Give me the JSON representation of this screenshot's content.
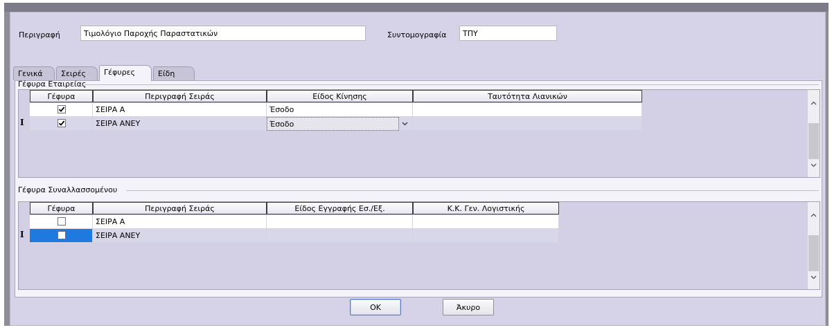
{
  "header": {
    "description_label": "Περιγραφή",
    "description_value": "Τιμολόγιο Παροχής Παραστατικών",
    "abbreviation_label": "Συντομογραφία",
    "abbreviation_value": "ΤΠΥ"
  },
  "tabs": [
    {
      "label": "Γενικά",
      "active": false
    },
    {
      "label": "Σειρές",
      "active": false
    },
    {
      "label": "Γέφυρες",
      "active": true
    },
    {
      "label": "Είδη",
      "active": false
    }
  ],
  "company_bridge": {
    "title": "Γέφυρα Εταιρείας",
    "columns": [
      "Γέφυρα",
      "Περιγραφή Σειράς",
      "Είδος Κίνησης",
      "Ταυτότητα Λιανικών"
    ],
    "rows": [
      {
        "checked": true,
        "series": "ΣΕΙΡΑ Α",
        "movement": "Έσοδο",
        "retail_id": ""
      },
      {
        "checked": true,
        "series": "ΣΕΙΡΑ ΑΝΕΥ",
        "movement": "Έσοδο",
        "retail_id": ""
      }
    ]
  },
  "counterparty_bridge": {
    "title": "Γέφυρα Συναλλασσομένου",
    "columns": [
      "Γέφυρα",
      "Περιγραφή Σειράς",
      "Είδος Εγγραφής Εσ./Εξ.",
      "Κ.Κ. Γεν. Λογιστικής"
    ],
    "rows": [
      {
        "checked": false,
        "series": "ΣΕΙΡΑ Α",
        "entry_type": "",
        "gl_account": ""
      },
      {
        "checked": false,
        "series": "ΣΕΙΡΑ ΑΝΕΥ",
        "entry_type": "",
        "gl_account": ""
      }
    ]
  },
  "buttons": {
    "ok": "OK",
    "cancel": "Άκυρο"
  },
  "colors": {
    "window_bg": "#d6d3e9",
    "selected_row": "#d8d6e9",
    "focus_blue": "#1f7ae0"
  }
}
